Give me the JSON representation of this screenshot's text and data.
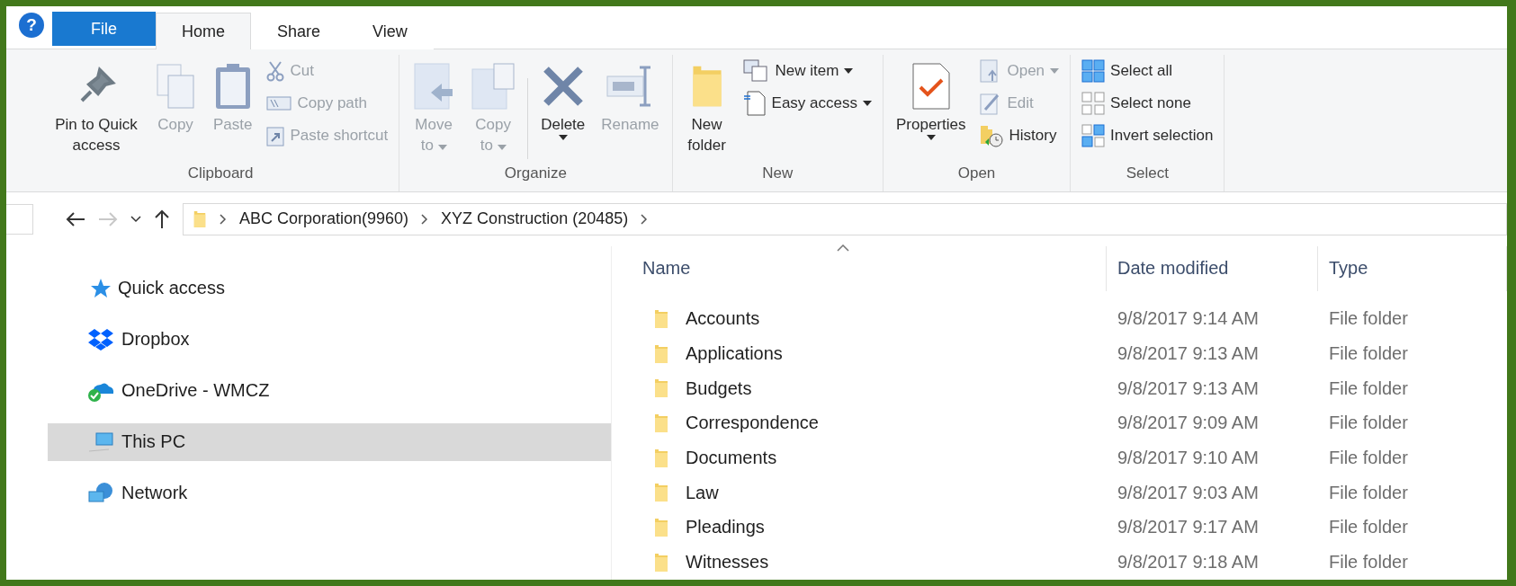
{
  "help": {
    "label": "?"
  },
  "tabs": [
    {
      "label": "File",
      "kind": "file",
      "selected": false
    },
    {
      "label": "Home",
      "kind": "tab",
      "selected": true
    },
    {
      "label": "Share",
      "kind": "tab",
      "selected": false
    },
    {
      "label": "View",
      "kind": "tab",
      "selected": false
    }
  ],
  "ribbon": [
    {
      "label": "Clipboard",
      "items": [
        {
          "kind": "large",
          "label": "Pin to Quick access",
          "disabled": false
        },
        {
          "kind": "large",
          "label": "Copy",
          "disabled": true
        },
        {
          "kind": "large",
          "label": "Paste",
          "disabled": true
        },
        {
          "kind": "stack",
          "items": [
            {
              "label": "Cut",
              "disabled": true
            },
            {
              "label": "Copy path",
              "disabled": true
            },
            {
              "label": "Paste shortcut",
              "disabled": true
            }
          ]
        }
      ]
    },
    {
      "label": "Organize",
      "items": [
        {
          "kind": "large",
          "label": "Move to",
          "disabled": true,
          "caret": true
        },
        {
          "kind": "large",
          "label": "Copy to",
          "disabled": true,
          "caret": true
        },
        {
          "kind": "divider"
        },
        {
          "kind": "split",
          "label": "Delete",
          "disabled": false
        },
        {
          "kind": "large",
          "label": "Rename",
          "disabled": true
        }
      ]
    },
    {
      "label": "New",
      "items": [
        {
          "kind": "large",
          "label": "New folder",
          "disabled": false
        },
        {
          "kind": "stack",
          "items": [
            {
              "label": "New item",
              "disabled": false,
              "caret": true
            },
            {
              "label": "Easy access",
              "disabled": false,
              "caret": true
            }
          ]
        }
      ]
    },
    {
      "label": "Open",
      "items": [
        {
          "kind": "split",
          "label": "Properties",
          "disabled": false
        },
        {
          "kind": "stack",
          "items": [
            {
              "label": "Open",
              "disabled": true,
              "caret": true
            },
            {
              "label": "Edit",
              "disabled": true
            },
            {
              "label": "History",
              "disabled": false
            }
          ]
        }
      ]
    },
    {
      "label": "Select",
      "items": [
        {
          "kind": "stack",
          "items": [
            {
              "label": "Select all",
              "disabled": false
            },
            {
              "label": "Select none",
              "disabled": false
            },
            {
              "label": "Invert selection",
              "disabled": false
            }
          ]
        }
      ]
    }
  ],
  "address": {
    "forward_disabled": true,
    "crumbs": [
      "ABC Corporation(9960)",
      "XYZ Construction (20485)"
    ]
  },
  "sidebar": {
    "items": [
      {
        "label": "Quick access",
        "selected": false
      },
      {
        "label": "Dropbox",
        "selected": false
      },
      {
        "label": "OneDrive - WMCZ",
        "selected": false
      },
      {
        "label": "This PC",
        "selected": true
      },
      {
        "label": "Network",
        "selected": false
      }
    ]
  },
  "table": {
    "columns": [
      "Name",
      "Date modified",
      "Type"
    ],
    "rows": [
      {
        "name": "Accounts",
        "date": "9/8/2017 9:14 AM",
        "type": "File folder"
      },
      {
        "name": "Applications",
        "date": "9/8/2017 9:13 AM",
        "type": "File folder"
      },
      {
        "name": "Budgets",
        "date": "9/8/2017 9:13 AM",
        "type": "File folder"
      },
      {
        "name": "Correspondence",
        "date": "9/8/2017 9:09 AM",
        "type": "File folder"
      },
      {
        "name": "Documents",
        "date": "9/8/2017 9:10 AM",
        "type": "File folder"
      },
      {
        "name": "Law",
        "date": "9/8/2017 9:03 AM",
        "type": "File folder"
      },
      {
        "name": "Pleadings",
        "date": "9/8/2017 9:17 AM",
        "type": "File folder"
      },
      {
        "name": "Witnesses",
        "date": "9/8/2017 9:18 AM",
        "type": "File folder"
      }
    ]
  }
}
